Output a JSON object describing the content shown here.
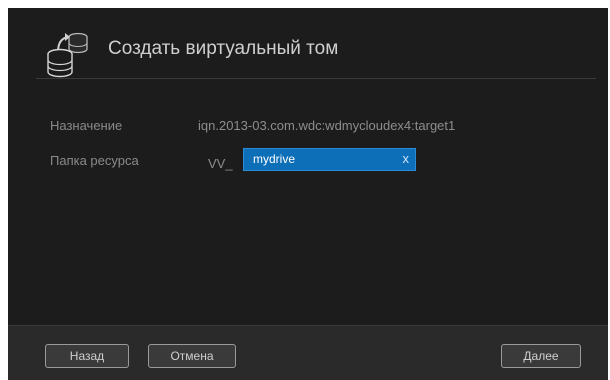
{
  "dialog": {
    "title": "Создать виртуальный том",
    "icon": "volume-stack-icon"
  },
  "form": {
    "target_label": "Назначение",
    "target_value": "iqn.2013-03.com.wdc:wdmycloudex4:target1",
    "folder_label": "Папка ресурса",
    "folder_prefix": "VV_",
    "folder_value": "mydrive",
    "clear_glyph": "x"
  },
  "footer": {
    "back_label": "Назад",
    "cancel_label": "Отмена",
    "next_label": "Далее"
  },
  "colors": {
    "dialog_bg": "#1c1c1c",
    "footer_bg": "#2a2a2a",
    "field_accent": "#0e6fb9"
  }
}
